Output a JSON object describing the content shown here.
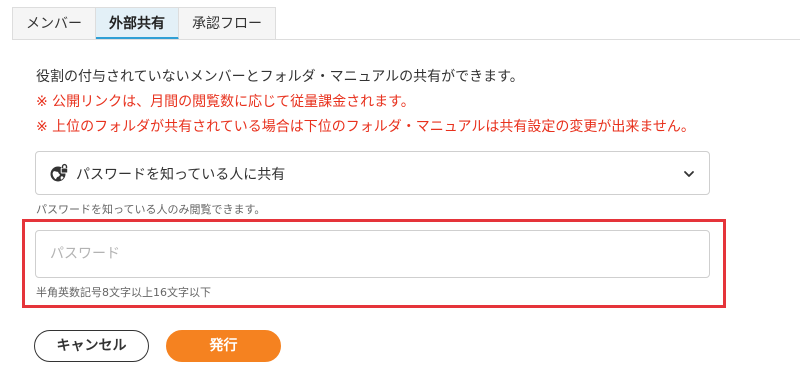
{
  "tabs": [
    {
      "label": "メンバー",
      "active": false
    },
    {
      "label": "外部共有",
      "active": true
    },
    {
      "label": "承認フロー",
      "active": false
    }
  ],
  "description": "役割の付与されていないメンバーとフォルダ・マニュアルの共有ができます。",
  "warnings": [
    "※ 公開リンクは、月間の閲覧数に応じて従量課金されます。",
    "※ 上位のフォルダが共有されている場合は下位のフォルダ・マニュアルは共有設定の変更が出来ません。"
  ],
  "share_select": {
    "icon": "globe-lock-icon",
    "selected": "パスワードを知っている人に共有",
    "hint": "パスワードを知っている人のみ閲覧できます。"
  },
  "password": {
    "value": "",
    "placeholder": "パスワード",
    "hint": "半角英数記号8文字以上16文字以下"
  },
  "buttons": {
    "cancel": "キャンセル",
    "issue": "発行"
  },
  "colors": {
    "accent_tab": "#2e9fd5",
    "warning": "#e8311d",
    "primary_button": "#f58220",
    "highlight_border": "#e5343a"
  }
}
